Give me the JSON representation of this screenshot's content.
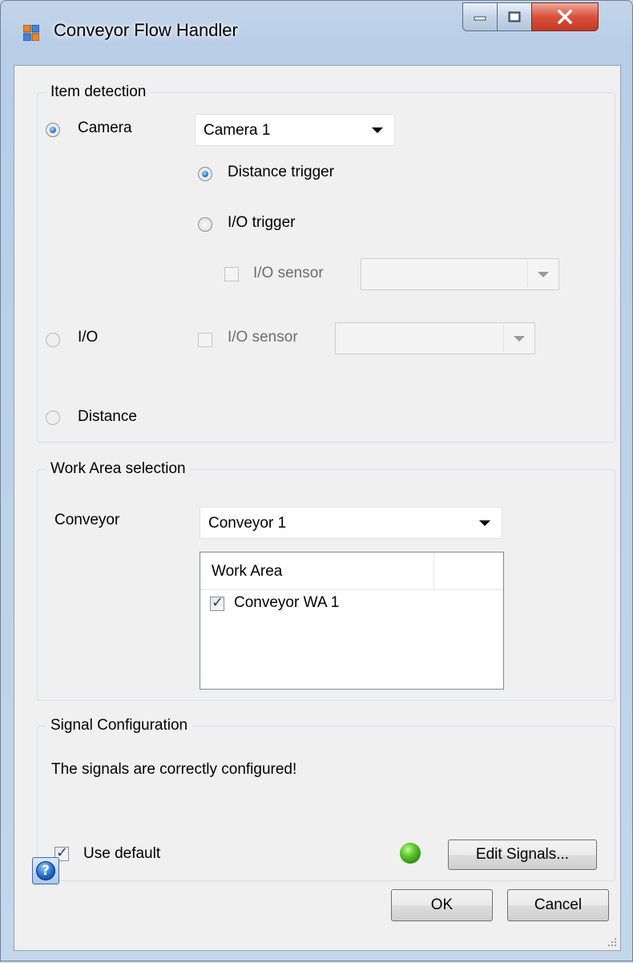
{
  "window": {
    "title": "Conveyor Flow Handler",
    "icon": "app-window-icon",
    "controls": {
      "minimize": "minimize-icon",
      "maximize": "maximize-icon",
      "close": "close-icon"
    }
  },
  "item_detection": {
    "legend": "Item detection",
    "camera": {
      "label": "Camera",
      "selected": true,
      "combo_value": "Camera 1"
    },
    "distance_trigger": {
      "label": "Distance trigger",
      "selected": true
    },
    "io_trigger": {
      "label": "I/O trigger",
      "selected": false
    },
    "io_trigger_sensor": {
      "label": "I/O sensor",
      "checked": false,
      "enabled": false,
      "combo_value": ""
    },
    "io": {
      "label": "I/O",
      "selected": false
    },
    "io_sensor": {
      "label": "I/O sensor",
      "checked": false,
      "enabled": false,
      "combo_value": ""
    },
    "distance": {
      "label": "Distance",
      "selected": false
    }
  },
  "work_area_selection": {
    "legend": "Work Area selection",
    "conveyor_label": "Conveyor",
    "conveyor_value": "Conveyor 1",
    "list": {
      "header": "Work Area",
      "items": [
        {
          "label": "Conveyor WA 1",
          "checked": true
        }
      ]
    }
  },
  "signal_configuration": {
    "legend": "Signal Configuration",
    "status_text": "The signals are correctly configured!",
    "status_color": "#3fb11b",
    "use_default": {
      "label": "Use default",
      "checked": true
    },
    "edit_button": "Edit Signals..."
  },
  "footer": {
    "ok": "OK",
    "cancel": "Cancel",
    "help_icon": "help-icon"
  }
}
